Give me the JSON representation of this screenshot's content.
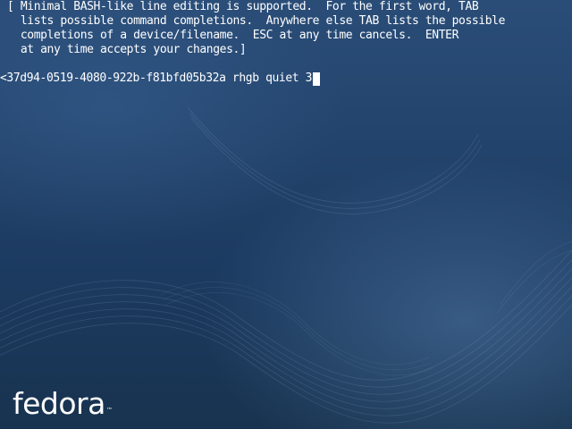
{
  "terminal": {
    "help_lines": [
      "[ Minimal BASH-like line editing is supported.  For the first word, TAB",
      "  lists possible command completions.  Anywhere else TAB lists the possible",
      "  completions of a device/filename.  ESC at any time cancels.  ENTER",
      "  at any time accepts your changes.]"
    ],
    "command_line": "<37d94-0519-4080-922b-f81bfd05b32a rhgb quiet 3"
  },
  "branding": {
    "logo_text": "fedora",
    "trademark": "™"
  },
  "colors": {
    "background": "#22436b",
    "text": "#ffffff"
  }
}
